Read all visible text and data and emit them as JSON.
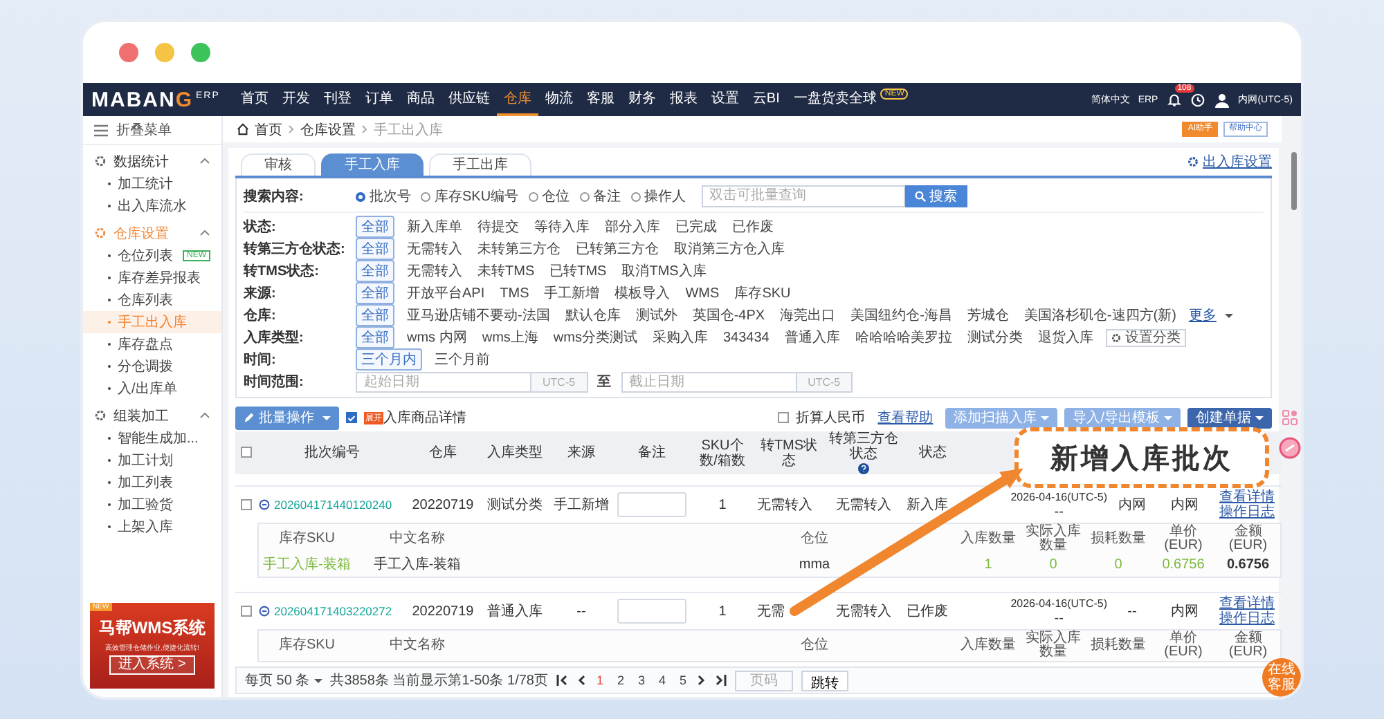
{
  "window_controls": [
    {
      "color": "#f07070"
    },
    {
      "color": "#f5c445"
    },
    {
      "color": "#3cc35a"
    }
  ],
  "navbar": {
    "logo": {
      "text": "MABAN",
      "accent": "G",
      "suffix": "ERP"
    },
    "menu": [
      {
        "label": "首页",
        "selected": false
      },
      {
        "label": "开发",
        "selected": false
      },
      {
        "label": "刊登",
        "selected": false
      },
      {
        "label": "订单",
        "selected": false
      },
      {
        "label": "商品",
        "selected": false
      },
      {
        "label": "供应链",
        "selected": false
      },
      {
        "label": "仓库",
        "selected": true
      },
      {
        "label": "物流",
        "selected": false
      },
      {
        "label": "客服",
        "selected": false
      },
      {
        "label": "财务",
        "selected": false
      },
      {
        "label": "报表",
        "selected": false
      },
      {
        "label": "设置",
        "selected": false
      },
      {
        "label": "云BI",
        "selected": false
      },
      {
        "label": "一盘货卖全球",
        "selected": false,
        "badge": "NEW"
      }
    ],
    "language": "简体中文",
    "erp": "ERP",
    "notification_count": "108",
    "timezone": "内网(UTC-5)"
  },
  "sidebar": {
    "collapse": "折叠菜单",
    "groups": [
      {
        "label": "数据统计",
        "expanded": true,
        "selected": false,
        "items": [
          {
            "label": "加工统计",
            "selected": false
          },
          {
            "label": "出入库流水",
            "selected": false
          }
        ]
      },
      {
        "label": "仓库设置",
        "expanded": true,
        "selected": true,
        "items": [
          {
            "label": "仓位列表",
            "selected": false,
            "badge": "NEW"
          },
          {
            "label": "库存差异报表",
            "selected": false
          },
          {
            "label": "仓库列表",
            "selected": false
          },
          {
            "label": "手工出入库",
            "selected": true
          },
          {
            "label": "库存盘点",
            "selected": false
          },
          {
            "label": "分仓调拨",
            "selected": false
          },
          {
            "label": "入/出库单",
            "selected": false
          }
        ]
      },
      {
        "label": "组装加工",
        "expanded": true,
        "selected": false,
        "items": [
          {
            "label": "智能生成加...",
            "selected": false
          },
          {
            "label": "加工计划",
            "selected": false
          },
          {
            "label": "加工列表",
            "selected": false
          },
          {
            "label": "加工验货",
            "selected": false
          },
          {
            "label": "上架入库",
            "selected": false
          }
        ]
      }
    ],
    "banner": {
      "tag": "NEW",
      "title": "马帮WMS系统",
      "subtitle": "高效管理仓储作业,便捷化流转!",
      "button": "进入系统 >"
    }
  },
  "breadcrumb": [
    "首页",
    "仓库设置",
    "手工出入库"
  ],
  "header_buttons": [
    {
      "label": "AI助手",
      "kind": "primary"
    },
    {
      "label": "帮助中心",
      "kind": "outline"
    }
  ],
  "tabs": [
    {
      "label": "审核",
      "selected": false
    },
    {
      "label": "手工入库",
      "selected": true
    },
    {
      "label": "手工出库",
      "selected": false
    }
  ],
  "settings_link": "出入库设置",
  "search": {
    "label": "搜索内容:",
    "options": [
      {
        "label": "批次号",
        "selected": true
      },
      {
        "label": "库存SKU编号",
        "selected": false
      },
      {
        "label": "仓位",
        "selected": false
      },
      {
        "label": "备注",
        "selected": false
      },
      {
        "label": "操作人",
        "selected": false
      }
    ],
    "placeholder": "双击可批量查询",
    "button": "搜索"
  },
  "filters": [
    {
      "label": "状态:",
      "options": [
        {
          "label": "全部",
          "selected": true
        },
        {
          "label": "新入库单",
          "selected": false
        },
        {
          "label": "待提交",
          "selected": false
        },
        {
          "label": "等待入库",
          "selected": false
        },
        {
          "label": "部分入库",
          "selected": false
        },
        {
          "label": "已完成",
          "selected": false
        },
        {
          "label": "已作废",
          "selected": false
        }
      ]
    },
    {
      "label": "转第三方仓状态:",
      "options": [
        {
          "label": "全部",
          "selected": true
        },
        {
          "label": "无需转入",
          "selected": false
        },
        {
          "label": "未转第三方仓",
          "selected": false
        },
        {
          "label": "已转第三方仓",
          "selected": false
        },
        {
          "label": "取消第三方仓入库",
          "selected": false
        }
      ]
    },
    {
      "label": "转TMS状态:",
      "options": [
        {
          "label": "全部",
          "selected": true
        },
        {
          "label": "无需转入",
          "selected": false
        },
        {
          "label": "未转TMS",
          "selected": false
        },
        {
          "label": "已转TMS",
          "selected": false
        },
        {
          "label": "取消TMS入库",
          "selected": false
        }
      ]
    },
    {
      "label": "来源:",
      "options": [
        {
          "label": "全部",
          "selected": true
        },
        {
          "label": "开放平台API",
          "selected": false
        },
        {
          "label": "TMS",
          "selected": false
        },
        {
          "label": "手工新增",
          "selected": false
        },
        {
          "label": "模板导入",
          "selected": false
        },
        {
          "label": "WMS",
          "selected": false
        },
        {
          "label": "库存SKU",
          "selected": false
        }
      ]
    },
    {
      "label": "仓库:",
      "options": [
        {
          "label": "全部",
          "selected": true
        },
        {
          "label": "亚马逊店铺不要动-法国",
          "selected": false
        },
        {
          "label": "默认仓库",
          "selected": false
        },
        {
          "label": "测试外",
          "selected": false
        },
        {
          "label": "英国仓-4PX",
          "selected": false
        },
        {
          "label": "海莞出口",
          "selected": false
        },
        {
          "label": "美国纽约仓-海昌",
          "selected": false
        },
        {
          "label": "芳城仓",
          "selected": false
        },
        {
          "label": "美国洛杉矶仓-速四方(新)",
          "selected": false
        }
      ],
      "more": "更多"
    },
    {
      "label": "入库类型:",
      "options": [
        {
          "label": "全部",
          "selected": true
        },
        {
          "label": "wms 内网",
          "selected": false
        },
        {
          "label": "wms上海",
          "selected": false
        },
        {
          "label": "wms分类测试",
          "selected": false
        },
        {
          "label": "采购入库",
          "selected": false
        },
        {
          "label": "343434",
          "selected": false
        },
        {
          "label": "普通入库",
          "selected": false
        },
        {
          "label": "哈哈哈哈美罗拉",
          "selected": false
        },
        {
          "label": "测试分类",
          "selected": false
        },
        {
          "label": "退货入库",
          "selected": false
        }
      ],
      "action": "设置分类"
    },
    {
      "label": "时间:",
      "options": [
        {
          "label": "三个月内",
          "selected": true
        },
        {
          "label": "三个月前",
          "selected": false
        }
      ]
    }
  ],
  "date_range": {
    "label": "时间范围:",
    "start_placeholder": "起始日期",
    "start_zone": "UTC-5",
    "separator": "至",
    "end_placeholder": "截止日期",
    "end_zone": "UTC-5"
  },
  "toolbar": {
    "batch": "批量操作",
    "detail_toggle": {
      "checked": true,
      "tag": "展开",
      "label": "入库商品详情"
    },
    "rmb": {
      "checked": false,
      "label": "折算人民币"
    },
    "help": "查看帮助",
    "buttons": [
      "添加扫描入库",
      "导入/导出模板",
      "创建单据"
    ]
  },
  "table": {
    "select_all": {
      "checked": false
    },
    "columns": [
      "批次编号",
      "仓库",
      "入库类型",
      "来源",
      "备注",
      "SKU个数/箱数",
      "转TMS状态",
      "转第三方仓状态",
      "状态"
    ],
    "rows": [
      {
        "checked": false,
        "batch": "202604171440120240",
        "warehouse": "20220719",
        "type": "测试分类",
        "source": "手工新增",
        "sku_count": "1",
        "tms": "无需转入",
        "third_party": "无需转入",
        "status": "新入库",
        "date": "2026-04-16(UTC-5)",
        "date_sub": "--",
        "column_12": "内网",
        "column_13": "内网",
        "actions": [
          "查看详情",
          "操作日志"
        ],
        "detail": {
          "columns": [
            "库存SKU",
            "中文名称",
            "仓位",
            "入库数量",
            "实际入库数量",
            "损耗数量",
            "单价(EUR)",
            "金额(EUR)"
          ],
          "rows": [
            {
              "sku": "手工入库-装箱",
              "name": "手工入库-装箱",
              "location": "mma",
              "qty": "1",
              "actual": "0",
              "loss": "0",
              "price": "0.6756",
              "amount": "0.6756"
            }
          ]
        }
      },
      {
        "checked": false,
        "batch": "202604171403220272",
        "warehouse": "20220719",
        "type": "普通入库",
        "source": "--",
        "sku_count": "1",
        "tms": "无需",
        "third_party": "无需转入",
        "status": "已作废",
        "date": "2026-04-16(UTC-5)",
        "date_sub": "--",
        "column_12": "--",
        "column_13": "内网",
        "actions": [
          "查看详情",
          "操作日志"
        ],
        "detail": {
          "columns": [
            "库存SKU",
            "中文名称",
            "仓位",
            "入库数量",
            "实际入库数量",
            "损耗数量",
            "单价(EUR)",
            "金额(EUR)"
          ]
        }
      }
    ]
  },
  "pagination": {
    "per_page": "每页 50 条",
    "summary": "共3858条 当前显示第1-50条 1/78页",
    "pages": [
      {
        "label": "1",
        "selected": true
      },
      {
        "label": "2",
        "selected": false
      },
      {
        "label": "3",
        "selected": false
      },
      {
        "label": "4",
        "selected": false
      },
      {
        "label": "5",
        "selected": false
      }
    ],
    "placeholder": "页码",
    "button": "跳转"
  },
  "callout": "新增入库批次",
  "service_button": "在线客服"
}
